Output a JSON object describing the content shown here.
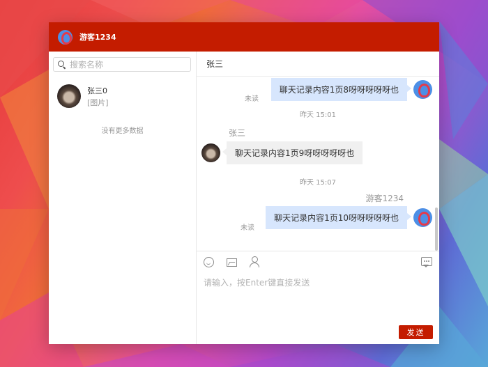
{
  "app": {
    "title_user": "游客1234",
    "brand_color": "#c41c00"
  },
  "sidebar": {
    "search_placeholder": "搜索名称",
    "contacts": [
      {
        "name": "张三0",
        "preview": "[图片]"
      }
    ],
    "footer_text": "没有更多数据"
  },
  "chat": {
    "header_title": "张三",
    "messages": [
      {
        "side": "right",
        "text": "聊天记录内容1页8呀呀呀呀呀也",
        "status": "未读"
      },
      {
        "type": "time",
        "text": "昨天 15:01"
      },
      {
        "side": "left",
        "sender": "张三",
        "text": "聊天记录内容1页9呀呀呀呀呀也"
      },
      {
        "type": "time",
        "text": "昨天 15:07"
      },
      {
        "side": "right",
        "sender": "游客1234",
        "text": "聊天记录内容1页10呀呀呀呀呀也",
        "status": "未读"
      }
    ]
  },
  "composer": {
    "tools": [
      "emoji-icon",
      "image-icon",
      "contact-icon",
      "chat-bubble-icon"
    ],
    "input_placeholder": "请输入，按Enter键直接发送",
    "send_label": "发送"
  }
}
